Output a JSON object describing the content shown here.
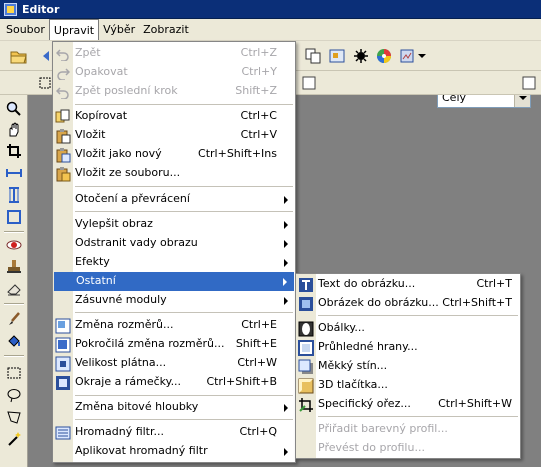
{
  "window": {
    "title": "Editor"
  },
  "menubar": [
    {
      "name": "menu-soubor",
      "label": "Soubor"
    },
    {
      "name": "menu-upravit",
      "label": "Upravit"
    },
    {
      "name": "menu-vyber",
      "label": "Výběr"
    },
    {
      "name": "menu-zobrazit",
      "label": "Zobrazit"
    }
  ],
  "toolbar": {
    "zoom_value": "Celý"
  },
  "edit_menu": {
    "items": [
      {
        "label": "Zpět",
        "shortcut": "Ctrl+Z",
        "disabled": true,
        "icon": "undo-icon"
      },
      {
        "label": "Opakovat",
        "shortcut": "Ctrl+Y",
        "disabled": true,
        "icon": "redo-icon"
      },
      {
        "label": "Zpět poslední krok",
        "shortcut": "Shift+Z",
        "disabled": true,
        "icon": "undo-last-step-icon"
      },
      {
        "label": "Kopírovat",
        "shortcut": "Ctrl+C",
        "icon": "copy-icon"
      },
      {
        "label": "Vložit",
        "shortcut": "Ctrl+V",
        "icon": "paste-icon"
      },
      {
        "label": "Vložit jako nový",
        "shortcut": "Ctrl+Shift+Ins",
        "icon": "paste-as-new-icon"
      },
      {
        "label": "Vložit ze souboru...",
        "shortcut": "",
        "icon": "paste-from-file-icon"
      },
      {
        "label": "Otočení a převrácení",
        "submenu": true
      },
      {
        "label": "Vylepšit obraz",
        "submenu": true
      },
      {
        "label": "Odstranit vady obrazu",
        "submenu": true
      },
      {
        "label": "Efekty",
        "submenu": true
      },
      {
        "label": "Ostatní",
        "submenu": true,
        "highlighted": true
      },
      {
        "label": "Zásuvné moduly",
        "submenu": true
      },
      {
        "label": "Změna rozměrů...",
        "shortcut": "Ctrl+E",
        "icon": "resize-icon"
      },
      {
        "label": "Pokročilá změna rozměrů...",
        "shortcut": "Shift+E",
        "icon": "advanced-resize-icon"
      },
      {
        "label": "Velikost plátna...",
        "shortcut": "Ctrl+W",
        "icon": "canvas-size-icon"
      },
      {
        "label": "Okraje a rámečky...",
        "shortcut": "Ctrl+Shift+B",
        "icon": "borders-frames-icon"
      },
      {
        "label": "Změna bitové hloubky",
        "submenu": true
      },
      {
        "label": "Hromadný filtr...",
        "shortcut": "Ctrl+Q",
        "icon": "batch-filter-icon"
      },
      {
        "label": "Aplikovat hromadný filtr",
        "submenu": true
      }
    ]
  },
  "other_submenu": {
    "items": [
      {
        "label": "Text do obrázku...",
        "shortcut": "Ctrl+T",
        "icon": "text-to-image-icon"
      },
      {
        "label": "Obrázek do obrázku...",
        "shortcut": "Ctrl+Shift+T",
        "icon": "image-to-image-icon"
      },
      {
        "label": "Obálky...",
        "shortcut": "",
        "icon": "envelopes-icon"
      },
      {
        "label": "Průhledné hrany...",
        "shortcut": "",
        "icon": "transparent-edges-icon"
      },
      {
        "label": "Měkký stín...",
        "shortcut": "",
        "icon": "soft-shadow-icon"
      },
      {
        "label": "3D tlačítka...",
        "shortcut": "",
        "icon": "3d-buttons-icon"
      },
      {
        "label": "Specifický ořez...",
        "shortcut": "Ctrl+Shift+W",
        "icon": "specific-crop-icon"
      },
      {
        "label": "Přiřadit barevný profil...",
        "shortcut": "",
        "disabled": true
      },
      {
        "label": "Převést do profilu...",
        "shortcut": "",
        "disabled": true
      }
    ]
  },
  "colors": {
    "highlight": "#316ac5",
    "titlebar": "#0b2f78",
    "canvas": "#808080",
    "disabled_text": "#a7a6aa"
  }
}
